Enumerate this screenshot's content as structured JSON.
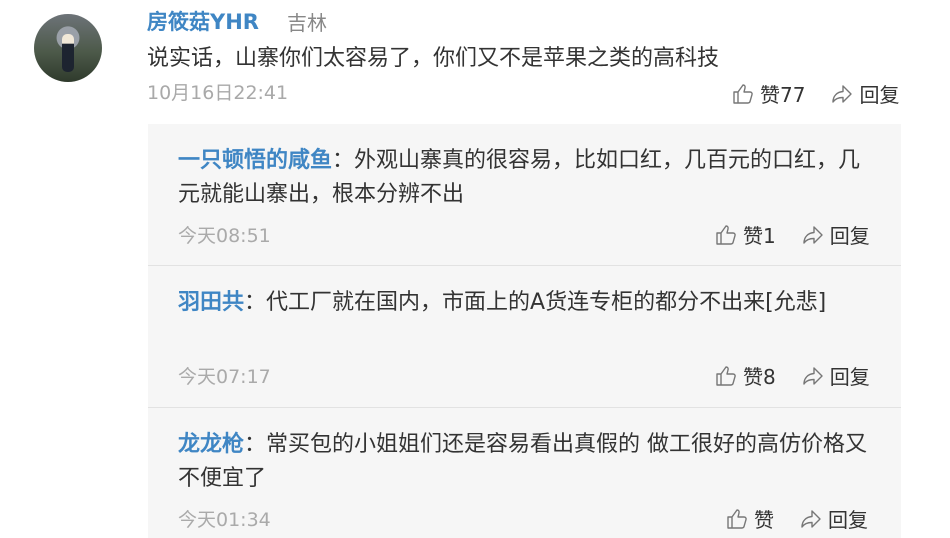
{
  "comment": {
    "author": "房筱菇YHR",
    "location": "吉林",
    "text": "说实话，山寨你们太容易了，你们又不是苹果之类的高科技",
    "time": "10月16日22:41",
    "like_label": "赞77",
    "reply_label": "回复"
  },
  "replies": [
    {
      "author": "一只顿悟的咸鱼",
      "text": "外观山寨真的很容易，比如口红，几百元的口红，几元就能山寨出，根本分辨不出",
      "time": "今天08:51",
      "like_label": "赞1",
      "reply_label": "回复"
    },
    {
      "author": "羽田共",
      "text": "代工厂就在国内，市面上的A货连专柜的都分不出来[允悲]",
      "time": "今天07:17",
      "like_label": "赞8",
      "reply_label": "回复"
    },
    {
      "author": "龙龙枪",
      "text": "常买包的小姐姐们还是容易看出真假的 做工很好的高仿价格又不便宜了",
      "time": "今天01:34",
      "like_label": "赞",
      "reply_label": "回复"
    }
  ],
  "icons": {
    "like": "thumbs-up-icon",
    "reply": "share-arrow-icon"
  }
}
